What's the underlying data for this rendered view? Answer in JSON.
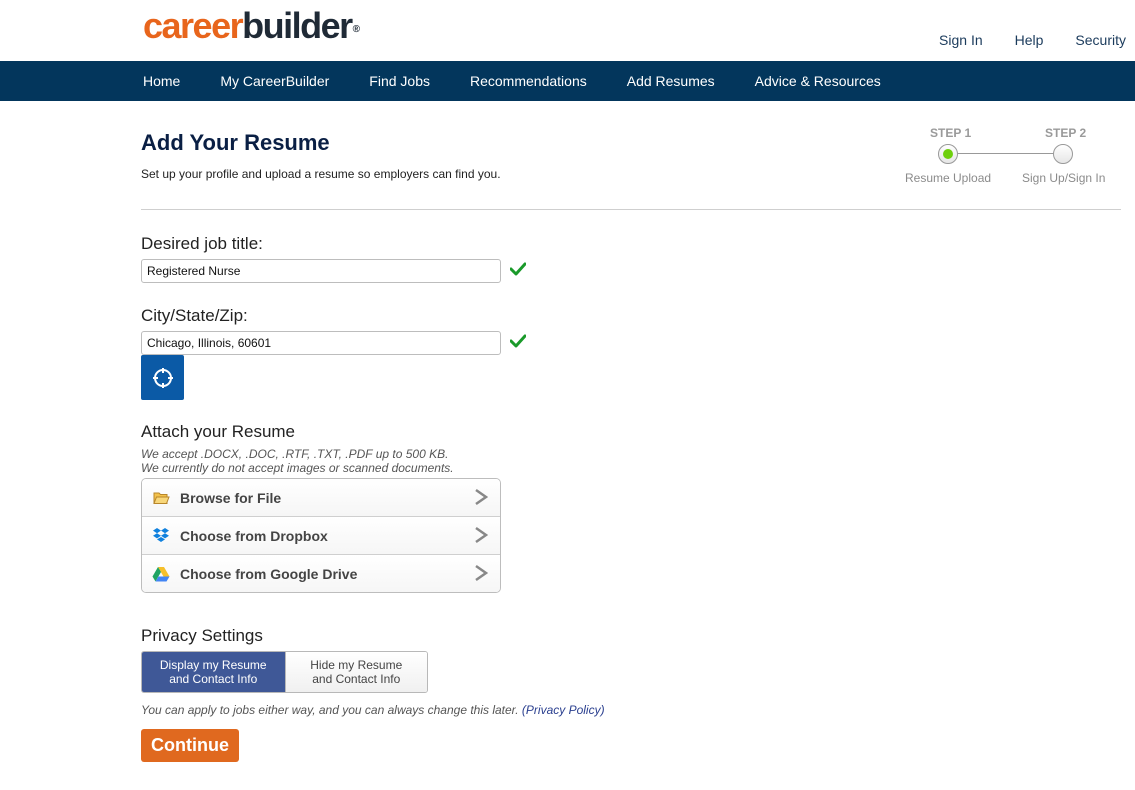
{
  "brand": {
    "logo_part1": "career",
    "logo_part2": "builder",
    "logo_mark": "®"
  },
  "util_links": [
    "Sign In",
    "Help",
    "Security"
  ],
  "nav": [
    "Home",
    "My CareerBuilder",
    "Find Jobs",
    "Recommendations",
    "Add Resumes",
    "Advice & Resources"
  ],
  "page": {
    "title": "Add Your Resume",
    "subtitle": "Set up your profile and upload a resume so employers can find you."
  },
  "steps": [
    {
      "label": "STEP 1",
      "caption": "Resume Upload",
      "active": true
    },
    {
      "label": "STEP 2",
      "caption": "Sign Up/Sign In",
      "active": false
    }
  ],
  "form": {
    "job_title_label": "Desired job title:",
    "job_title_value": "Registered Nurse",
    "location_label": "City/State/Zip:",
    "location_value": "Chicago, Illinois, 60601"
  },
  "attach": {
    "heading": "Attach your Resume",
    "note_line1": "We accept .DOCX, .DOC, .RTF, .TXT, .PDF up to 500 KB.",
    "note_line2": "We currently do not accept images or scanned documents.",
    "options": [
      {
        "label": "Browse for File",
        "icon": "folder-icon"
      },
      {
        "label": "Choose from Dropbox",
        "icon": "dropbox-icon"
      },
      {
        "label": "Choose from Google Drive",
        "icon": "google-drive-icon"
      }
    ]
  },
  "privacy": {
    "heading": "Privacy Settings",
    "display_line1": "Display my Resume",
    "display_line2": "and Contact Info",
    "hide_line1": "Hide my Resume",
    "hide_line2": "and Contact Info",
    "note": "You can apply to jobs either way, and you can always change this later.",
    "policy_link": "(Privacy Policy)"
  },
  "continue_label": "Continue",
  "colors": {
    "nav_bg": "#03365c",
    "brand_orange": "#e8651c",
    "toggle_active": "#3f5897",
    "check_green": "#1a9a2a",
    "step_active": "#6ed00c",
    "locate_btn": "#0b5aa6"
  }
}
